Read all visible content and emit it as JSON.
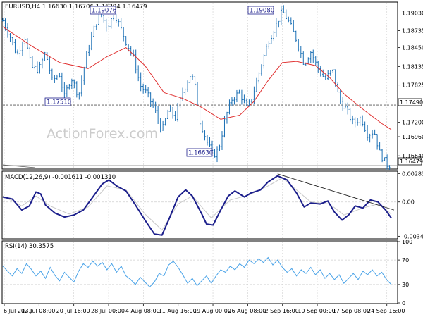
{
  "header": {
    "symbol_line": "EURUSD,H4  1.16630 1.16706 1.16394 1.16479",
    "watermark": "ActionForex.com"
  },
  "colors": {
    "candle": "#1a6fb4",
    "ma_line": "#e03030",
    "macd_line": "#1c1f8c",
    "signal_line": "#c8c8c8",
    "rsi_line": "#4aa3e8",
    "trendline": "#222222",
    "grid": "#cfcfcf",
    "level_dashed": "#555555"
  },
  "chart_data": [
    {
      "type": "candlestick",
      "title": "EURUSD,H4  1.16630 1.16706 1.16394 1.16479",
      "ohlc_last": {
        "open": 1.1663,
        "high": 1.16706,
        "low": 1.16394,
        "close": 1.16479
      },
      "y_ticks": [
        1.1903,
        1.18735,
        1.1845,
        1.18135,
        1.17825,
        1.1749,
        1.172,
        1.1696,
        1.1664,
        1.16479
      ],
      "ylim": [
        1.1643,
        1.192
      ],
      "x_tick_labels": [
        "6 Jul 2021",
        "13 Jul 08:00",
        "20 Jul 16:00",
        "28 Jul 00:00",
        "4 Aug 08:00",
        "11 Aug 16:00",
        "19 Aug 00:00",
        "26 Aug 08:00",
        "2 Sep 16:00",
        "10 Sep 00:00",
        "17 Sep 08:00",
        "24 Sep 16:00"
      ],
      "annotations": [
        {
          "label": "1.19076",
          "value": 1.19076
        },
        {
          "label": "1.19080",
          "value": 1.1908
        },
        {
          "label": "1.17510",
          "value": 1.1751
        },
        {
          "label": "1.16630",
          "value": 1.1663
        }
      ],
      "horizontal_level": {
        "label": "1.17490",
        "value": 1.1749
      },
      "current_price_label": "1.16479",
      "price_path": [
        [
          0,
          1.189
        ],
        [
          8,
          1.1862
        ],
        [
          15,
          1.1832
        ],
        [
          23,
          1.1865
        ],
        [
          30,
          1.1812
        ],
        [
          38,
          1.1808
        ],
        [
          45,
          1.1838
        ],
        [
          52,
          1.179
        ],
        [
          60,
          1.18
        ],
        [
          65,
          1.1762
        ],
        [
          72,
          1.1796
        ],
        [
          80,
          1.1765
        ],
        [
          88,
          1.183
        ],
        [
          95,
          1.187
        ],
        [
          102,
          1.1905
        ],
        [
          110,
          1.188
        ],
        [
          118,
          1.1902
        ],
        [
          125,
          1.1875
        ],
        [
          130,
          1.1855
        ],
        [
          138,
          1.1828
        ],
        [
          145,
          1.1782
        ],
        [
          152,
          1.1768
        ],
        [
          160,
          1.1742
        ],
        [
          168,
          1.1705
        ],
        [
          175,
          1.1742
        ],
        [
          182,
          1.1728
        ],
        [
          190,
          1.1772
        ],
        [
          198,
          1.18
        ],
        [
          202,
          1.1788
        ],
        [
          208,
          1.1722
        ],
        [
          215,
          1.169
        ],
        [
          222,
          1.1664
        ],
        [
          228,
          1.1676
        ],
        [
          235,
          1.1728
        ],
        [
          242,
          1.176
        ],
        [
          250,
          1.177
        ],
        [
          258,
          1.1742
        ],
        [
          265,
          1.1772
        ],
        [
          272,
          1.1812
        ],
        [
          280,
          1.1855
        ],
        [
          288,
          1.1882
        ],
        [
          295,
          1.1906
        ],
        [
          302,
          1.1888
        ],
        [
          310,
          1.1858
        ],
        [
          318,
          1.1818
        ],
        [
          325,
          1.1838
        ],
        [
          332,
          1.1812
        ],
        [
          340,
          1.1792
        ],
        [
          348,
          1.1808
        ],
        [
          355,
          1.1758
        ],
        [
          362,
          1.1742
        ],
        [
          370,
          1.1718
        ],
        [
          378,
          1.1728
        ],
        [
          385,
          1.17
        ],
        [
          392,
          1.1705
        ],
        [
          398,
          1.1668
        ],
        [
          405,
          1.165
        ],
        [
          410,
          1.1648
        ]
      ],
      "moving_average": [
        [
          0,
          1.188
        ],
        [
          30,
          1.1848
        ],
        [
          60,
          1.182
        ],
        [
          90,
          1.181
        ],
        [
          110,
          1.183
        ],
        [
          130,
          1.1845
        ],
        [
          150,
          1.1815
        ],
        [
          170,
          1.177
        ],
        [
          190,
          1.176
        ],
        [
          210,
          1.1745
        ],
        [
          230,
          1.1725
        ],
        [
          250,
          1.1732
        ],
        [
          265,
          1.1755
        ],
        [
          280,
          1.179
        ],
        [
          295,
          1.182
        ],
        [
          310,
          1.1822
        ],
        [
          330,
          1.1815
        ],
        [
          345,
          1.1795
        ],
        [
          360,
          1.1768
        ],
        [
          380,
          1.1742
        ],
        [
          400,
          1.1718
        ],
        [
          410,
          1.1708
        ]
      ]
    },
    {
      "type": "line",
      "title": "MACD(12,26,9) -0.001611 -0.001310",
      "y_ticks": [
        0.002836,
        0.0,
        -0.003415
      ],
      "ylim": [
        -0.0036,
        0.003
      ],
      "trendline": [
        [
          290,
          0.0028
        ],
        [
          410,
          -0.0008
        ]
      ],
      "series": [
        {
          "name": "MACD",
          "values": [
            [
              0,
              0.0005
            ],
            [
              10,
              0.0003
            ],
            [
              20,
              -0.0008
            ],
            [
              28,
              -0.0004
            ],
            [
              35,
              0.001
            ],
            [
              40,
              0.0008
            ],
            [
              45,
              -0.0003
            ],
            [
              55,
              -0.0011
            ],
            [
              65,
              -0.0015
            ],
            [
              75,
              -0.0013
            ],
            [
              85,
              -0.0008
            ],
            [
              95,
              0.0005
            ],
            [
              105,
              0.0018
            ],
            [
              112,
              0.0022
            ],
            [
              120,
              0.0016
            ],
            [
              130,
              0.0011
            ],
            [
              140,
              -0.0003
            ],
            [
              150,
              -0.0018
            ],
            [
              160,
              -0.0032
            ],
            [
              168,
              -0.0033
            ],
            [
              175,
              -0.0018
            ],
            [
              185,
              0.0005
            ],
            [
              193,
              0.0012
            ],
            [
              200,
              0.0006
            ],
            [
              210,
              -0.0012
            ],
            [
              215,
              -0.0022
            ],
            [
              222,
              -0.0023
            ],
            [
              230,
              -0.0008
            ],
            [
              238,
              0.0006
            ],
            [
              245,
              0.0011
            ],
            [
              255,
              0.0005
            ],
            [
              262,
              0.0009
            ],
            [
              272,
              0.0012
            ],
            [
              280,
              0.002
            ],
            [
              290,
              0.0026
            ],
            [
              300,
              0.0022
            ],
            [
              310,
              0.0009
            ],
            [
              318,
              -0.0005
            ],
            [
              325,
              -0.0001
            ],
            [
              335,
              -0.0002
            ],
            [
              343,
              0.0001
            ],
            [
              350,
              -0.001
            ],
            [
              358,
              -0.0018
            ],
            [
              365,
              -0.0013
            ],
            [
              372,
              -0.0004
            ],
            [
              380,
              -0.0006
            ],
            [
              388,
              0.0002
            ],
            [
              396,
              0.0
            ],
            [
              404,
              -0.0008
            ],
            [
              410,
              -0.0016
            ]
          ]
        },
        {
          "name": "Signal",
          "values": [
            [
              0,
              0.0006
            ],
            [
              20,
              -0.0004
            ],
            [
              35,
              0.0006
            ],
            [
              50,
              -0.0004
            ],
            [
              70,
              -0.0012
            ],
            [
              90,
              -0.0005
            ],
            [
              110,
              0.0016
            ],
            [
              130,
              0.0012
            ],
            [
              150,
              -0.0012
            ],
            [
              168,
              -0.0028
            ],
            [
              185,
              -0.0002
            ],
            [
              200,
              0.0006
            ],
            [
              220,
              -0.0016
            ],
            [
              240,
              0.0002
            ],
            [
              260,
              0.0007
            ],
            [
              280,
              0.0016
            ],
            [
              295,
              0.0024
            ],
            [
              310,
              0.0012
            ],
            [
              325,
              0.0
            ],
            [
              345,
              -0.0002
            ],
            [
              360,
              -0.0013
            ],
            [
              380,
              -0.0006
            ],
            [
              396,
              -0.0002
            ],
            [
              410,
              -0.0012
            ]
          ]
        }
      ]
    },
    {
      "type": "line",
      "title": "RSI(14) 30.3575",
      "y_ticks": [
        100,
        70,
        30,
        0
      ],
      "ylim": [
        0,
        100
      ],
      "series": [
        {
          "name": "RSI(14)",
          "values": [
            [
              0,
              60
            ],
            [
              5,
              52
            ],
            [
              10,
              44
            ],
            [
              15,
              56
            ],
            [
              20,
              48
            ],
            [
              25,
              64
            ],
            [
              30,
              55
            ],
            [
              35,
              44
            ],
            [
              40,
              52
            ],
            [
              45,
              40
            ],
            [
              50,
              58
            ],
            [
              55,
              45
            ],
            [
              60,
              36
            ],
            [
              65,
              50
            ],
            [
              70,
              42
            ],
            [
              75,
              34
            ],
            [
              80,
              52
            ],
            [
              85,
              64
            ],
            [
              90,
              58
            ],
            [
              95,
              68
            ],
            [
              100,
              60
            ],
            [
              105,
              66
            ],
            [
              110,
              54
            ],
            [
              115,
              64
            ],
            [
              120,
              50
            ],
            [
              125,
              60
            ],
            [
              130,
              44
            ],
            [
              135,
              38
            ],
            [
              140,
              30
            ],
            [
              145,
              42
            ],
            [
              150,
              34
            ],
            [
              155,
              26
            ],
            [
              160,
              34
            ],
            [
              165,
              48
            ],
            [
              170,
              44
            ],
            [
              175,
              62
            ],
            [
              180,
              68
            ],
            [
              185,
              58
            ],
            [
              190,
              46
            ],
            [
              195,
              32
            ],
            [
              200,
              40
            ],
            [
              205,
              28
            ],
            [
              210,
              36
            ],
            [
              215,
              44
            ],
            [
              220,
              32
            ],
            [
              225,
              44
            ],
            [
              230,
              54
            ],
            [
              235,
              50
            ],
            [
              240,
              60
            ],
            [
              245,
              54
            ],
            [
              250,
              64
            ],
            [
              255,
              58
            ],
            [
              260,
              70
            ],
            [
              265,
              64
            ],
            [
              270,
              72
            ],
            [
              275,
              66
            ],
            [
              280,
              74
            ],
            [
              285,
              62
            ],
            [
              290,
              70
            ],
            [
              295,
              58
            ],
            [
              300,
              50
            ],
            [
              305,
              56
            ],
            [
              310,
              44
            ],
            [
              315,
              54
            ],
            [
              320,
              48
            ],
            [
              325,
              58
            ],
            [
              330,
              46
            ],
            [
              335,
              54
            ],
            [
              340,
              40
            ],
            [
              345,
              48
            ],
            [
              350,
              38
            ],
            [
              355,
              46
            ],
            [
              360,
              32
            ],
            [
              365,
              40
            ],
            [
              370,
              48
            ],
            [
              375,
              38
            ],
            [
              380,
              52
            ],
            [
              385,
              46
            ],
            [
              390,
              54
            ],
            [
              395,
              44
            ],
            [
              400,
              50
            ],
            [
              405,
              38
            ],
            [
              410,
              30
            ]
          ]
        }
      ]
    }
  ]
}
